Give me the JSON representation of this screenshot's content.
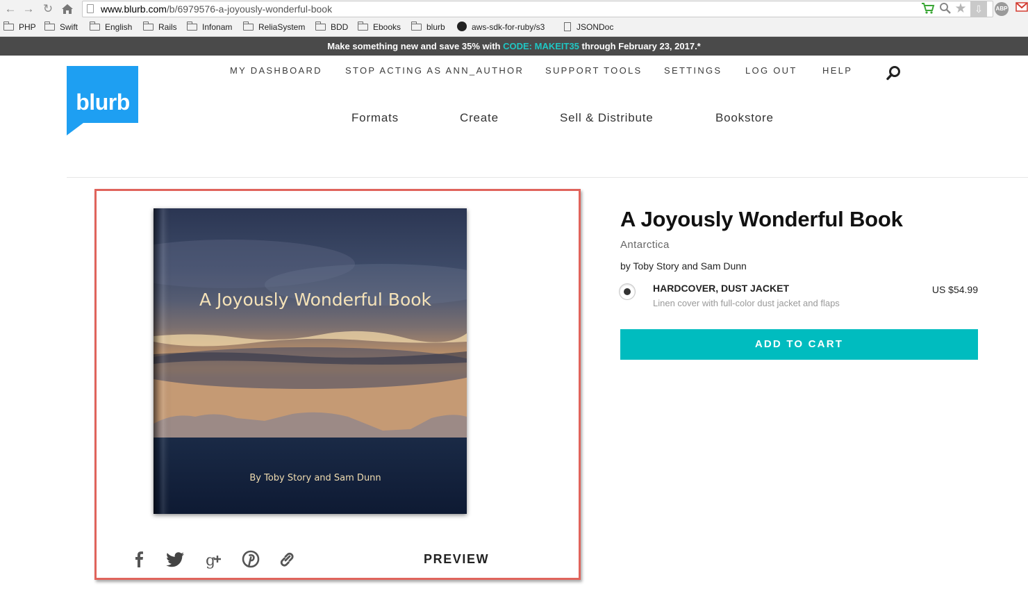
{
  "browser": {
    "url_host": "www.blurb.com",
    "url_path": "/b/6979576-a-joyously-wonderful-book",
    "nav_icons": [
      "back-arrow-icon",
      "forward-arrow-icon",
      "reload-icon",
      "home-icon"
    ],
    "ext_icons": [
      "cart-icon",
      "zoom-icon",
      "star-icon",
      "download-icon",
      "adblock-icon",
      "gmail-icon"
    ],
    "ext_abp_label": "ABP",
    "bookmarks": [
      {
        "label": "PHP",
        "icon": "folder-icon"
      },
      {
        "label": "Swift",
        "icon": "folder-icon"
      },
      {
        "label": "English",
        "icon": "folder-icon"
      },
      {
        "label": "Rails",
        "icon": "folder-icon"
      },
      {
        "label": "Infonam",
        "icon": "folder-icon"
      },
      {
        "label": "ReliaSystem",
        "icon": "folder-icon"
      },
      {
        "label": "BDD",
        "icon": "folder-icon"
      },
      {
        "label": "Ebooks",
        "icon": "folder-icon"
      },
      {
        "label": "blurb",
        "icon": "folder-icon"
      },
      {
        "label": "aws-sdk-for-ruby/s3",
        "icon": "github-icon"
      },
      {
        "label": "JSONDoc",
        "icon": "document-icon"
      }
    ]
  },
  "promo": {
    "prefix": "Make something new and save 35% with ",
    "code": "CODE: MAKEIT35",
    "suffix": " through February 23, 2017.*"
  },
  "header": {
    "logo_text": "blurb",
    "brand_color": "#1e9ff2",
    "top_nav": [
      "MY DASHBOARD",
      "STOP ACTING AS ANN_AUTHOR",
      "SUPPORT TOOLS",
      "SETTINGS",
      "LOG OUT",
      "HELP"
    ],
    "main_nav": [
      "Formats",
      "Create",
      "Sell & Distribute",
      "Bookstore"
    ]
  },
  "book": {
    "cover_title": "A Joyously Wonderful Book",
    "cover_byline": "By Toby Story and Sam Dunn",
    "title": "A Joyously Wonderful Book",
    "subtitle": "Antarctica",
    "byline": "by Toby Story and Sam Dunn",
    "option_name": "HARDCOVER, DUST JACKET",
    "option_desc": "Linen cover with full-color dust jacket and flaps",
    "option_price": "US $54.99",
    "option_selected": true,
    "add_to_cart": "ADD TO CART",
    "accent_color": "#00bcbf"
  },
  "share": {
    "icons": [
      "facebook-icon",
      "twitter-icon",
      "google-plus-icon",
      "pinterest-icon",
      "link-icon"
    ],
    "preview_label": "PREVIEW"
  },
  "panel_highlight_color": "#e0645c"
}
